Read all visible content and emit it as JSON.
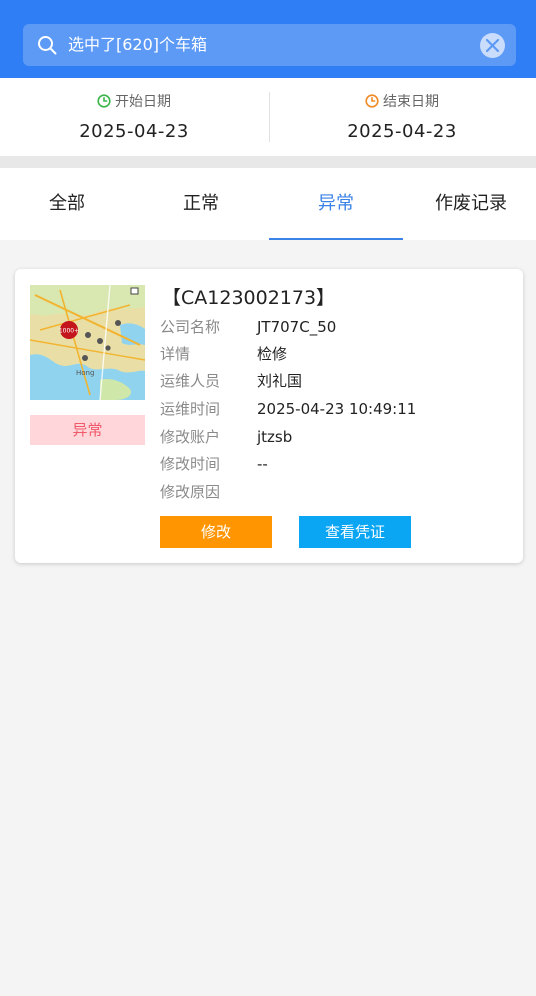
{
  "search": {
    "text": "选中了[620]个车箱"
  },
  "dates": {
    "start_label": "开始日期",
    "start_value": "2025-04-23",
    "end_label": "结束日期",
    "end_value": "2025-04-23"
  },
  "tabs": [
    {
      "label": "全部"
    },
    {
      "label": "正常"
    },
    {
      "label": "异常"
    },
    {
      "label": "作废记录"
    }
  ],
  "card": {
    "title": "【CA123002173】",
    "status": "异常",
    "map_labels": {
      "cluster": "1000+",
      "city": "Hong"
    },
    "rows": [
      {
        "k": "公司名称",
        "v": "JT707C_50"
      },
      {
        "k": "详情",
        "v": "检修"
      },
      {
        "k": "运维人员",
        "v": "刘礼国"
      },
      {
        "k": "运维时间",
        "v": "2025-04-23 10:49:11"
      },
      {
        "k": "修改账户",
        "v": "jtzsb"
      },
      {
        "k": "修改时间",
        "v": "--"
      },
      {
        "k": "修改原因",
        "v": ""
      }
    ],
    "edit_label": "修改",
    "view_label": "查看凭证"
  },
  "colors": {
    "header": "#2f7ef5",
    "active_tab": "#3b82e6",
    "edit_button": "#ff9500",
    "view_button": "#0aa6f4",
    "status_bg": "#ffd6d9",
    "status_text": "#f05a6b",
    "start_clock": "#3bb54a",
    "end_clock": "#f08a24"
  },
  "icons": {
    "search": "search-icon",
    "clear": "close-icon",
    "start": "clock-icon",
    "end": "clock-icon"
  }
}
